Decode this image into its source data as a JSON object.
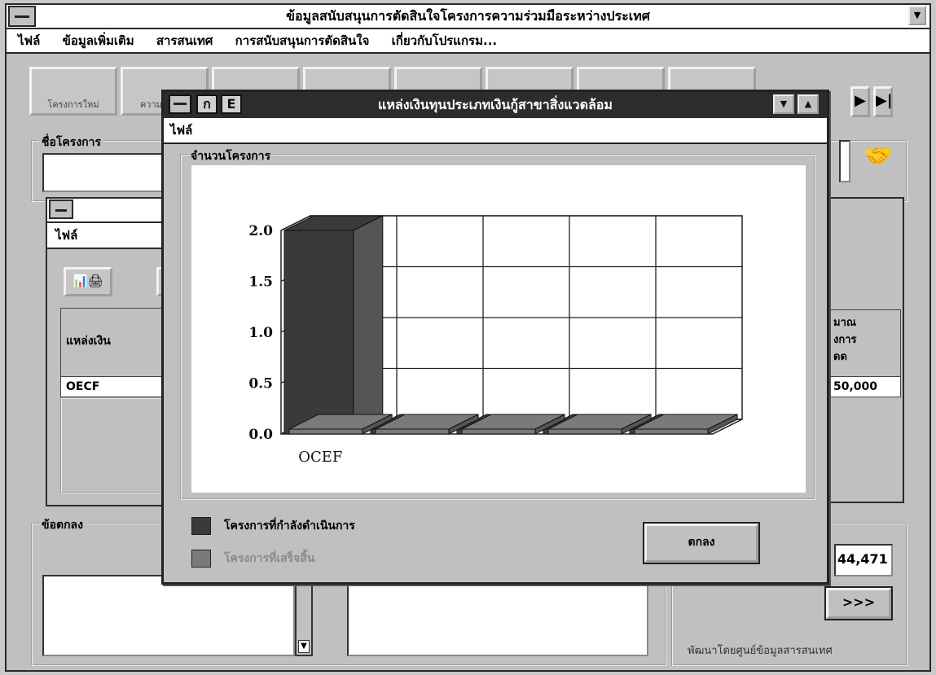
{
  "main": {
    "title": "ข้อมูลสนับสนุนการตัดสินใจโครงการความร่วมมือระหว่างประเทศ",
    "menu": [
      "ไฟล์",
      "ข้อมูลเพิ่มเติม",
      "สารสนเทศ",
      "การสนับสนุนการตัดสินใจ",
      "เกี่ยวกับโปรแกรม..."
    ],
    "toolbar": [
      "โครงการใหม่",
      "ความร่วมมือ"
    ],
    "project_name_label": "ชื่อโครงการ",
    "agreement_label": "ข้อตกลง",
    "amount_value": "44,471",
    "next_button": ">>>",
    "footer_note": "พัฒนาโดยศูนย์ข้อมูลสารสนเทศ"
  },
  "child": {
    "menu_file": "ไฟล์",
    "grid_header": "แหล่งเงิน",
    "grid_row": "OECF",
    "right_header": "มาณ\nงการ\nดด",
    "right_value": "50,000"
  },
  "dialog": {
    "title": "แหล่งเงินทุนประเภทเงินกู้สาขาสิ่งแวดล้อม",
    "menu_file": "ไฟล์",
    "group_label": "จำนวนโครงการ",
    "legend": [
      {
        "label": "โครงการที่กำลังดำเนินการ",
        "color": "#3a3a3a"
      },
      {
        "label": "โครงการที่เสร็จสิ้น",
        "color": "#7a7a7a"
      }
    ],
    "ok_button": "ตกลง"
  },
  "chart_data": {
    "type": "bar",
    "categories": [
      "OCEF",
      "",
      "",
      "",
      ""
    ],
    "series": [
      {
        "values": [
          2,
          0,
          0,
          0,
          0
        ],
        "color": "#3a3a3a"
      },
      {
        "values": [
          0,
          0,
          0,
          0,
          0
        ],
        "color": "#7a7a7a"
      }
    ],
    "yticks": [
      "0.0",
      "0.5",
      "1.0",
      "1.5",
      "2.0"
    ],
    "ylim": [
      0,
      2
    ]
  }
}
